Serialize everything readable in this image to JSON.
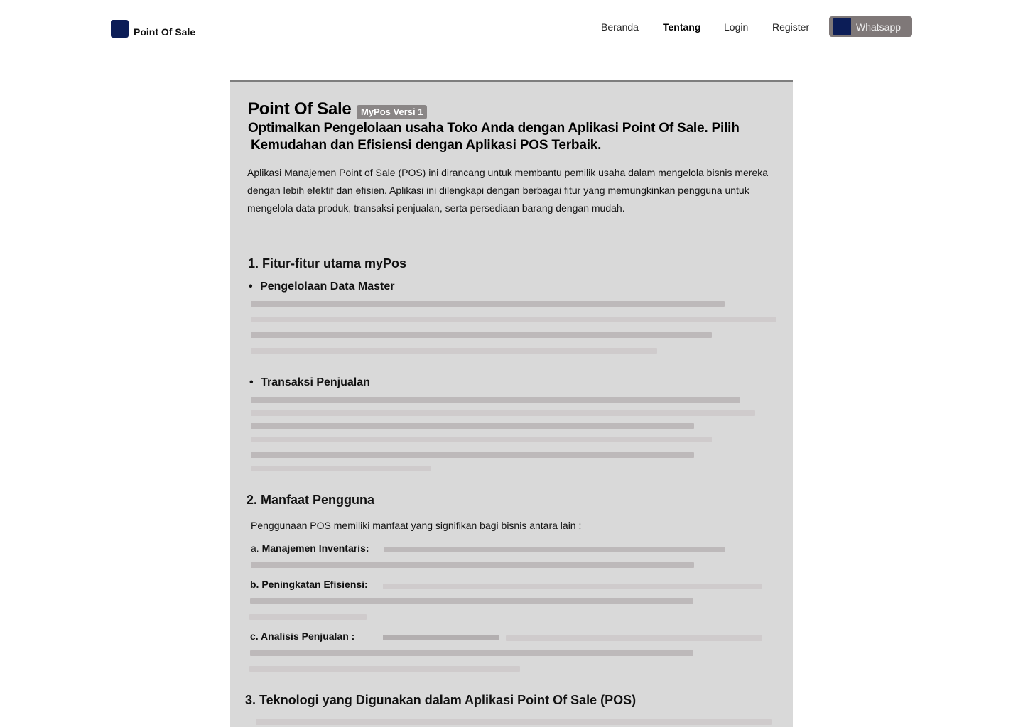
{
  "brand": {
    "name": "Point Of Sale"
  },
  "nav": {
    "beranda": "Beranda",
    "tentang": "Tentang",
    "login": "Login",
    "register": "Register",
    "whatsapp": "Whatsapp"
  },
  "hero": {
    "title": "Point Of Sale",
    "badge": "MyPos Versi 1",
    "subtitle_line1": "Optimalkan Pengelolaan usaha Toko Anda dengan Aplikasi Point Of Sale. Pilih",
    "subtitle_line2": "Kemudahan dan Efisiensi dengan Aplikasi POS Terbaik.",
    "intro": "Aplikasi Manajemen Point of Sale (POS) ini dirancang untuk membantu pemilik usaha dalam mengelola bisnis mereka dengan lebih efektif dan efisien. Aplikasi ini dilengkapi dengan berbagai fitur yang memungkinkan pengguna untuk mengelola data produk, transaksi penjualan, serta persediaan barang dengan mudah."
  },
  "section1": {
    "heading": "1. Fitur-fitur utama myPos",
    "bullet1": "Pengelolaan Data Master",
    "bullet2": "Transaksi Penjualan"
  },
  "section2": {
    "heading": "2. Manfaat Pengguna",
    "intro": "Penggunaan POS memiliki manfaat yang signifikan bagi bisnis antara lain :",
    "a_prefix": "a.",
    "a_label": "Manajemen Inventaris:",
    "b_label": "b. Peningkatan Efisiensi:",
    "c_label": "c. Analisis Penjualan :"
  },
  "section3": {
    "heading": "3. Teknologi yang Digunakan dalam Aplikasi Point Of Sale (POS)"
  }
}
